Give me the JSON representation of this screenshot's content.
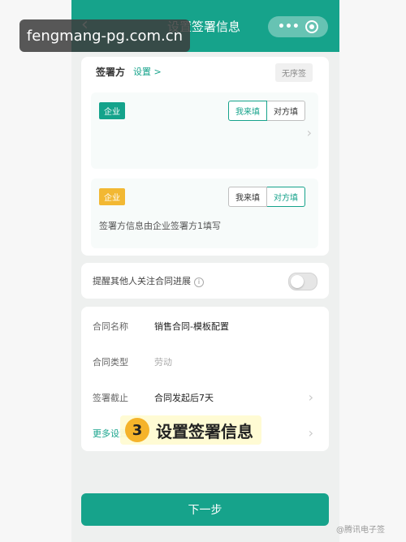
{
  "watermark": "fengmang-pg.com.cn",
  "header": {
    "title": "设置签署信息",
    "back_icon": "chevron-left-icon",
    "more_icon": "more-icon",
    "close_icon": "target-icon"
  },
  "signer": {
    "title": "签署方",
    "settings_link": "设置 >",
    "no_order_label": "无序签",
    "parties": [
      {
        "type": "企业",
        "badge_color": "#14a38b",
        "options": [
          "我来填",
          "对方填"
        ],
        "selected": "我来填",
        "info": ""
      },
      {
        "type": "企业",
        "badge_color": "#f2b833",
        "options": [
          "我来填",
          "对方填"
        ],
        "selected": "对方填",
        "info": "签署方信息由企业签署方1填写"
      }
    ]
  },
  "remind": {
    "label": "提醒其他人关注合同进展",
    "enabled": false
  },
  "contract": {
    "fields": [
      {
        "name": "合同名称",
        "value": "销售合同-模板配置",
        "placeholder": ""
      },
      {
        "name": "合同类型",
        "value": "",
        "placeholder": "劳动"
      },
      {
        "name": "签署截止",
        "value": "合同发起后7天",
        "placeholder": ""
      },
      {
        "name": "更多设置",
        "value": "",
        "placeholder": ""
      }
    ]
  },
  "overlay": {
    "step": "3",
    "text": "设置签署信息"
  },
  "next_button": "下一步",
  "credit": "@腾讯电子签",
  "colors": {
    "primary": "#16a38b",
    "accent": "#f2b833"
  }
}
